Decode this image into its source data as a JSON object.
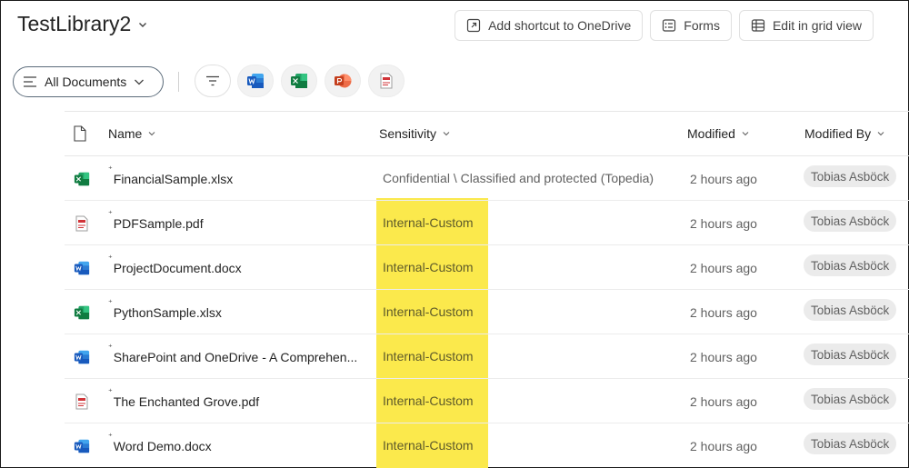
{
  "library": {
    "title": "TestLibrary2"
  },
  "actions": {
    "add_shortcut": "Add shortcut to OneDrive",
    "forms": "Forms",
    "grid_view": "Edit in grid view"
  },
  "toolbar": {
    "view_label": "All Documents"
  },
  "table": {
    "headers": {
      "name": "Name",
      "sensitivity": "Sensitivity",
      "modified": "Modified",
      "modified_by": "Modified By"
    },
    "rows": [
      {
        "icon": "excel-icon",
        "name": "FinancialSample.xlsx",
        "sensitivity": "Confidential \\ Classified and protected (Topedia)",
        "modified": "2 hours ago",
        "modified_by": "Tobias Asböck"
      },
      {
        "icon": "pdf-icon",
        "name": "PDFSample.pdf",
        "sensitivity": "Internal-Custom",
        "modified": "2 hours ago",
        "modified_by": "Tobias Asböck"
      },
      {
        "icon": "word-icon",
        "name": "ProjectDocument.docx",
        "sensitivity": "Internal-Custom",
        "modified": "2 hours ago",
        "modified_by": "Tobias Asböck"
      },
      {
        "icon": "excel-icon",
        "name": "PythonSample.xlsx",
        "sensitivity": "Internal-Custom",
        "modified": "2 hours ago",
        "modified_by": "Tobias Asböck"
      },
      {
        "icon": "word-icon",
        "name": "SharePoint and OneDrive - A Comprehen...",
        "sensitivity": "Internal-Custom",
        "modified": "2 hours ago",
        "modified_by": "Tobias Asböck"
      },
      {
        "icon": "pdf-icon",
        "name": "The Enchanted Grove.pdf",
        "sensitivity": "Internal-Custom",
        "modified": "2 hours ago",
        "modified_by": "Tobias Asböck"
      },
      {
        "icon": "word-icon",
        "name": "Word Demo.docx",
        "sensitivity": "Internal-Custom",
        "modified": "2 hours ago",
        "modified_by": "Tobias Asböck"
      }
    ]
  },
  "colors": {
    "highlight": "#fbe94c",
    "excel": "#107c41",
    "word": "#185abd",
    "powerpoint": "#c43e1c",
    "pdf": "#d13438"
  }
}
